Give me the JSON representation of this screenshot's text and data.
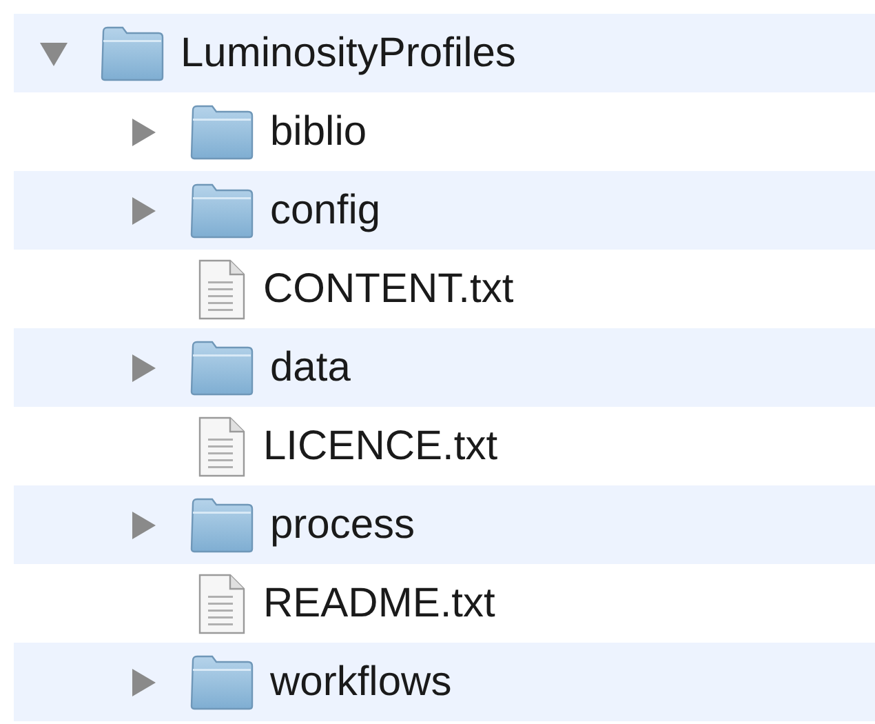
{
  "tree": [
    {
      "name": "LuminosityProfiles",
      "kind": "folder",
      "expanded": true,
      "children": [
        {
          "name": "biblio",
          "kind": "folder",
          "expanded": false
        },
        {
          "name": "config",
          "kind": "folder",
          "expanded": false
        },
        {
          "name": "CONTENT.txt",
          "kind": "file"
        },
        {
          "name": "data",
          "kind": "folder",
          "expanded": false
        },
        {
          "name": "LICENCE.txt",
          "kind": "file"
        },
        {
          "name": "process",
          "kind": "folder",
          "expanded": false
        },
        {
          "name": "README.txt",
          "kind": "file"
        },
        {
          "name": "workflows",
          "kind": "folder",
          "expanded": false
        }
      ]
    }
  ]
}
